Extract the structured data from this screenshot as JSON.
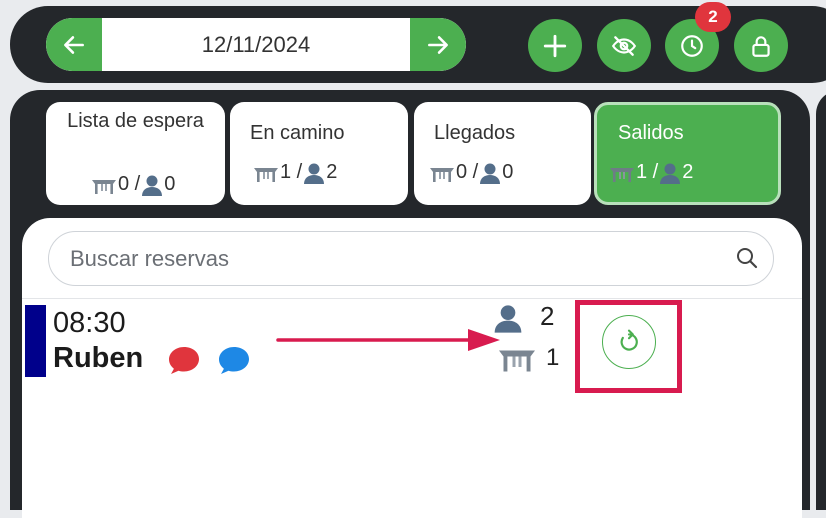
{
  "header": {
    "date_value": "12/11/2024",
    "notification_count": "2",
    "buttons": [
      "arrow-left-icon",
      "arrow-right-icon",
      "plus-icon",
      "eye-off-icon",
      "clock-icon",
      "lock-icon"
    ]
  },
  "tabs": [
    {
      "label": "Lista de espera",
      "tables": "0 /",
      "people": "0",
      "active": false
    },
    {
      "label": "En camino",
      "tables": "1 /",
      "people": "2",
      "active": false
    },
    {
      "label": "Llegados",
      "tables": "0 /",
      "people": "0",
      "active": false
    },
    {
      "label": "Salidos",
      "tables": "1 /",
      "people": "2",
      "active": true
    }
  ],
  "search": {
    "placeholder": "Buscar reservas"
  },
  "reservation": {
    "time": "08:30",
    "name": "Ruben",
    "people": "2",
    "tables": "1"
  },
  "colors": {
    "accent": "#4caf50",
    "dark": "#24272b",
    "badge": "#e0353d",
    "annotation": "#d81b4f",
    "marker": "#00008b",
    "comment_red": "#e0353d",
    "comment_blue": "#1e88e5"
  }
}
